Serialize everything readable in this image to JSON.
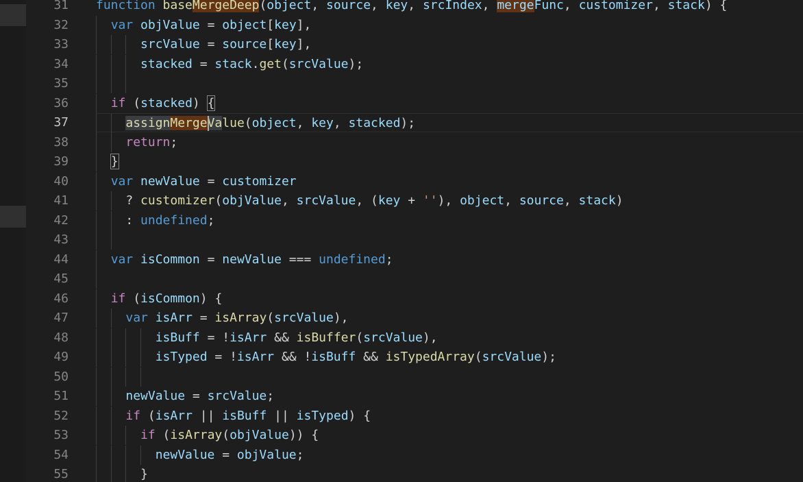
{
  "editor": {
    "language": "javascript",
    "current_line": 37,
    "lines": [
      {
        "n": "31",
        "tokens": [
          [
            "function",
            "dkw"
          ],
          [
            " ",
            "pun"
          ],
          [
            "base",
            "fn"
          ],
          [
            "MergeDeep",
            "fn hl"
          ],
          [
            "(",
            "pun"
          ],
          [
            "object",
            "var"
          ],
          [
            ", ",
            "pun"
          ],
          [
            "source",
            "var"
          ],
          [
            ", ",
            "pun"
          ],
          [
            "key",
            "var"
          ],
          [
            ", ",
            "pun"
          ],
          [
            "srcIndex",
            "var"
          ],
          [
            ", ",
            "pun"
          ],
          [
            "merge",
            "var hl"
          ],
          [
            "Func",
            "var"
          ],
          [
            ", ",
            "pun"
          ],
          [
            "customizer",
            "var"
          ],
          [
            ", ",
            "pun"
          ],
          [
            "stack",
            "var"
          ],
          [
            ") {",
            "pun"
          ]
        ]
      },
      {
        "n": "32",
        "tokens": [
          [
            "  ",
            "pun"
          ],
          [
            "var",
            "dkw"
          ],
          [
            " ",
            "pun"
          ],
          [
            "objValue",
            "var"
          ],
          [
            " = ",
            "pun"
          ],
          [
            "object",
            "var"
          ],
          [
            "[",
            "pun"
          ],
          [
            "key",
            "var"
          ],
          [
            "],",
            "pun"
          ]
        ]
      },
      {
        "n": "33",
        "tokens": [
          [
            "      ",
            "pun"
          ],
          [
            "srcValue",
            "var"
          ],
          [
            " = ",
            "pun"
          ],
          [
            "source",
            "var"
          ],
          [
            "[",
            "pun"
          ],
          [
            "key",
            "var"
          ],
          [
            "],",
            "pun"
          ]
        ]
      },
      {
        "n": "34",
        "tokens": [
          [
            "      ",
            "pun"
          ],
          [
            "stacked",
            "var"
          ],
          [
            " = ",
            "pun"
          ],
          [
            "stack",
            "var"
          ],
          [
            ".",
            "pun"
          ],
          [
            "get",
            "fn"
          ],
          [
            "(",
            "pun"
          ],
          [
            "srcValue",
            "var"
          ],
          [
            ");",
            "pun"
          ]
        ]
      },
      {
        "n": "35",
        "tokens": []
      },
      {
        "n": "36",
        "tokens": [
          [
            "  ",
            "pun"
          ],
          [
            "if",
            "kw"
          ],
          [
            " (",
            "pun"
          ],
          [
            "stacked",
            "var"
          ],
          [
            ") ",
            "pun"
          ],
          [
            "{",
            "pun brk"
          ]
        ]
      },
      {
        "n": "37",
        "tokens": [
          [
            "    ",
            "pun"
          ],
          [
            "assign",
            "fn sel"
          ],
          [
            "Merge",
            "fn hl"
          ],
          [
            "Va",
            "fn sel"
          ],
          [
            "lue",
            "fn"
          ],
          [
            "(",
            "pun"
          ],
          [
            "object",
            "var"
          ],
          [
            ", ",
            "pun"
          ],
          [
            "key",
            "var"
          ],
          [
            ", ",
            "pun"
          ],
          [
            "stacked",
            "var"
          ],
          [
            ");",
            "pun"
          ]
        ]
      },
      {
        "n": "38",
        "tokens": [
          [
            "    ",
            "pun"
          ],
          [
            "return",
            "kw"
          ],
          [
            ";",
            "pun"
          ]
        ]
      },
      {
        "n": "39",
        "tokens": [
          [
            "  ",
            "pun"
          ],
          [
            "}",
            "pun brk"
          ]
        ]
      },
      {
        "n": "40",
        "tokens": [
          [
            "  ",
            "pun"
          ],
          [
            "var",
            "dkw"
          ],
          [
            " ",
            "pun"
          ],
          [
            "newValue",
            "var"
          ],
          [
            " = ",
            "pun"
          ],
          [
            "customizer",
            "var"
          ]
        ]
      },
      {
        "n": "41",
        "tokens": [
          [
            "    ? ",
            "pun"
          ],
          [
            "customizer",
            "fn"
          ],
          [
            "(",
            "pun"
          ],
          [
            "objValue",
            "var"
          ],
          [
            ", ",
            "pun"
          ],
          [
            "srcValue",
            "var"
          ],
          [
            ", (",
            "pun"
          ],
          [
            "key",
            "var"
          ],
          [
            " + ",
            "pun"
          ],
          [
            "''",
            "str"
          ],
          [
            "), ",
            "pun"
          ],
          [
            "object",
            "var"
          ],
          [
            ", ",
            "pun"
          ],
          [
            "source",
            "var"
          ],
          [
            ", ",
            "pun"
          ],
          [
            "stack",
            "var"
          ],
          [
            ")",
            "pun"
          ]
        ]
      },
      {
        "n": "42",
        "tokens": [
          [
            "    : ",
            "pun"
          ],
          [
            "undefined",
            "dkw"
          ],
          [
            ";",
            "pun"
          ]
        ]
      },
      {
        "n": "43",
        "tokens": []
      },
      {
        "n": "44",
        "tokens": [
          [
            "  ",
            "pun"
          ],
          [
            "var",
            "dkw"
          ],
          [
            " ",
            "pun"
          ],
          [
            "isCommon",
            "var"
          ],
          [
            " = ",
            "pun"
          ],
          [
            "newValue",
            "var"
          ],
          [
            " === ",
            "pun"
          ],
          [
            "undefined",
            "dkw"
          ],
          [
            ";",
            "pun"
          ]
        ]
      },
      {
        "n": "45",
        "tokens": []
      },
      {
        "n": "46",
        "tokens": [
          [
            "  ",
            "pun"
          ],
          [
            "if",
            "kw"
          ],
          [
            " (",
            "pun"
          ],
          [
            "isCommon",
            "var"
          ],
          [
            ") {",
            "pun"
          ]
        ]
      },
      {
        "n": "47",
        "tokens": [
          [
            "    ",
            "pun"
          ],
          [
            "var",
            "dkw"
          ],
          [
            " ",
            "pun"
          ],
          [
            "isArr",
            "var"
          ],
          [
            " = ",
            "pun"
          ],
          [
            "isArray",
            "fn"
          ],
          [
            "(",
            "pun"
          ],
          [
            "srcValue",
            "var"
          ],
          [
            "),",
            "pun"
          ]
        ]
      },
      {
        "n": "48",
        "tokens": [
          [
            "        ",
            "pun"
          ],
          [
            "isBuff",
            "var"
          ],
          [
            " = !",
            "pun"
          ],
          [
            "isArr",
            "var"
          ],
          [
            " && ",
            "pun"
          ],
          [
            "isBuffer",
            "fn"
          ],
          [
            "(",
            "pun"
          ],
          [
            "srcValue",
            "var"
          ],
          [
            "),",
            "pun"
          ]
        ]
      },
      {
        "n": "49",
        "tokens": [
          [
            "        ",
            "pun"
          ],
          [
            "isTyped",
            "var"
          ],
          [
            " = !",
            "pun"
          ],
          [
            "isArr",
            "var"
          ],
          [
            " && !",
            "pun"
          ],
          [
            "isBuff",
            "var"
          ],
          [
            " && ",
            "pun"
          ],
          [
            "isTypedArray",
            "fn"
          ],
          [
            "(",
            "pun"
          ],
          [
            "srcValue",
            "var"
          ],
          [
            ");",
            "pun"
          ]
        ]
      },
      {
        "n": "50",
        "tokens": []
      },
      {
        "n": "51",
        "tokens": [
          [
            "    ",
            "pun"
          ],
          [
            "newValue",
            "var"
          ],
          [
            " = ",
            "pun"
          ],
          [
            "srcValue",
            "var"
          ],
          [
            ";",
            "pun"
          ]
        ]
      },
      {
        "n": "52",
        "tokens": [
          [
            "    ",
            "pun"
          ],
          [
            "if",
            "kw"
          ],
          [
            " (",
            "pun"
          ],
          [
            "isArr",
            "var"
          ],
          [
            " || ",
            "pun"
          ],
          [
            "isBuff",
            "var"
          ],
          [
            " || ",
            "pun"
          ],
          [
            "isTyped",
            "var"
          ],
          [
            ") {",
            "pun"
          ]
        ]
      },
      {
        "n": "53",
        "tokens": [
          [
            "      ",
            "pun"
          ],
          [
            "if",
            "kw"
          ],
          [
            " (",
            "pun"
          ],
          [
            "isArray",
            "fn"
          ],
          [
            "(",
            "pun"
          ],
          [
            "objValue",
            "var"
          ],
          [
            ")) {",
            "pun"
          ]
        ]
      },
      {
        "n": "54",
        "tokens": [
          [
            "        ",
            "pun"
          ],
          [
            "newValue",
            "var"
          ],
          [
            " = ",
            "pun"
          ],
          [
            "objValue",
            "var"
          ],
          [
            ";",
            "pun"
          ]
        ]
      },
      {
        "n": "55",
        "tokens": [
          [
            "      ",
            "pun"
          ],
          [
            "}",
            "pun"
          ]
        ]
      }
    ]
  },
  "colors": {
    "background": "#1e1e1e",
    "line_number": "#858585",
    "keyword_control": "#c586c0",
    "keyword_declaration": "#569cd6",
    "function": "#dcdcaa",
    "variable": "#9cdcfe",
    "string": "#ce9178",
    "punctuation": "#d4d4d4",
    "word_highlight": "#613214",
    "selection": "#3a3d41"
  }
}
